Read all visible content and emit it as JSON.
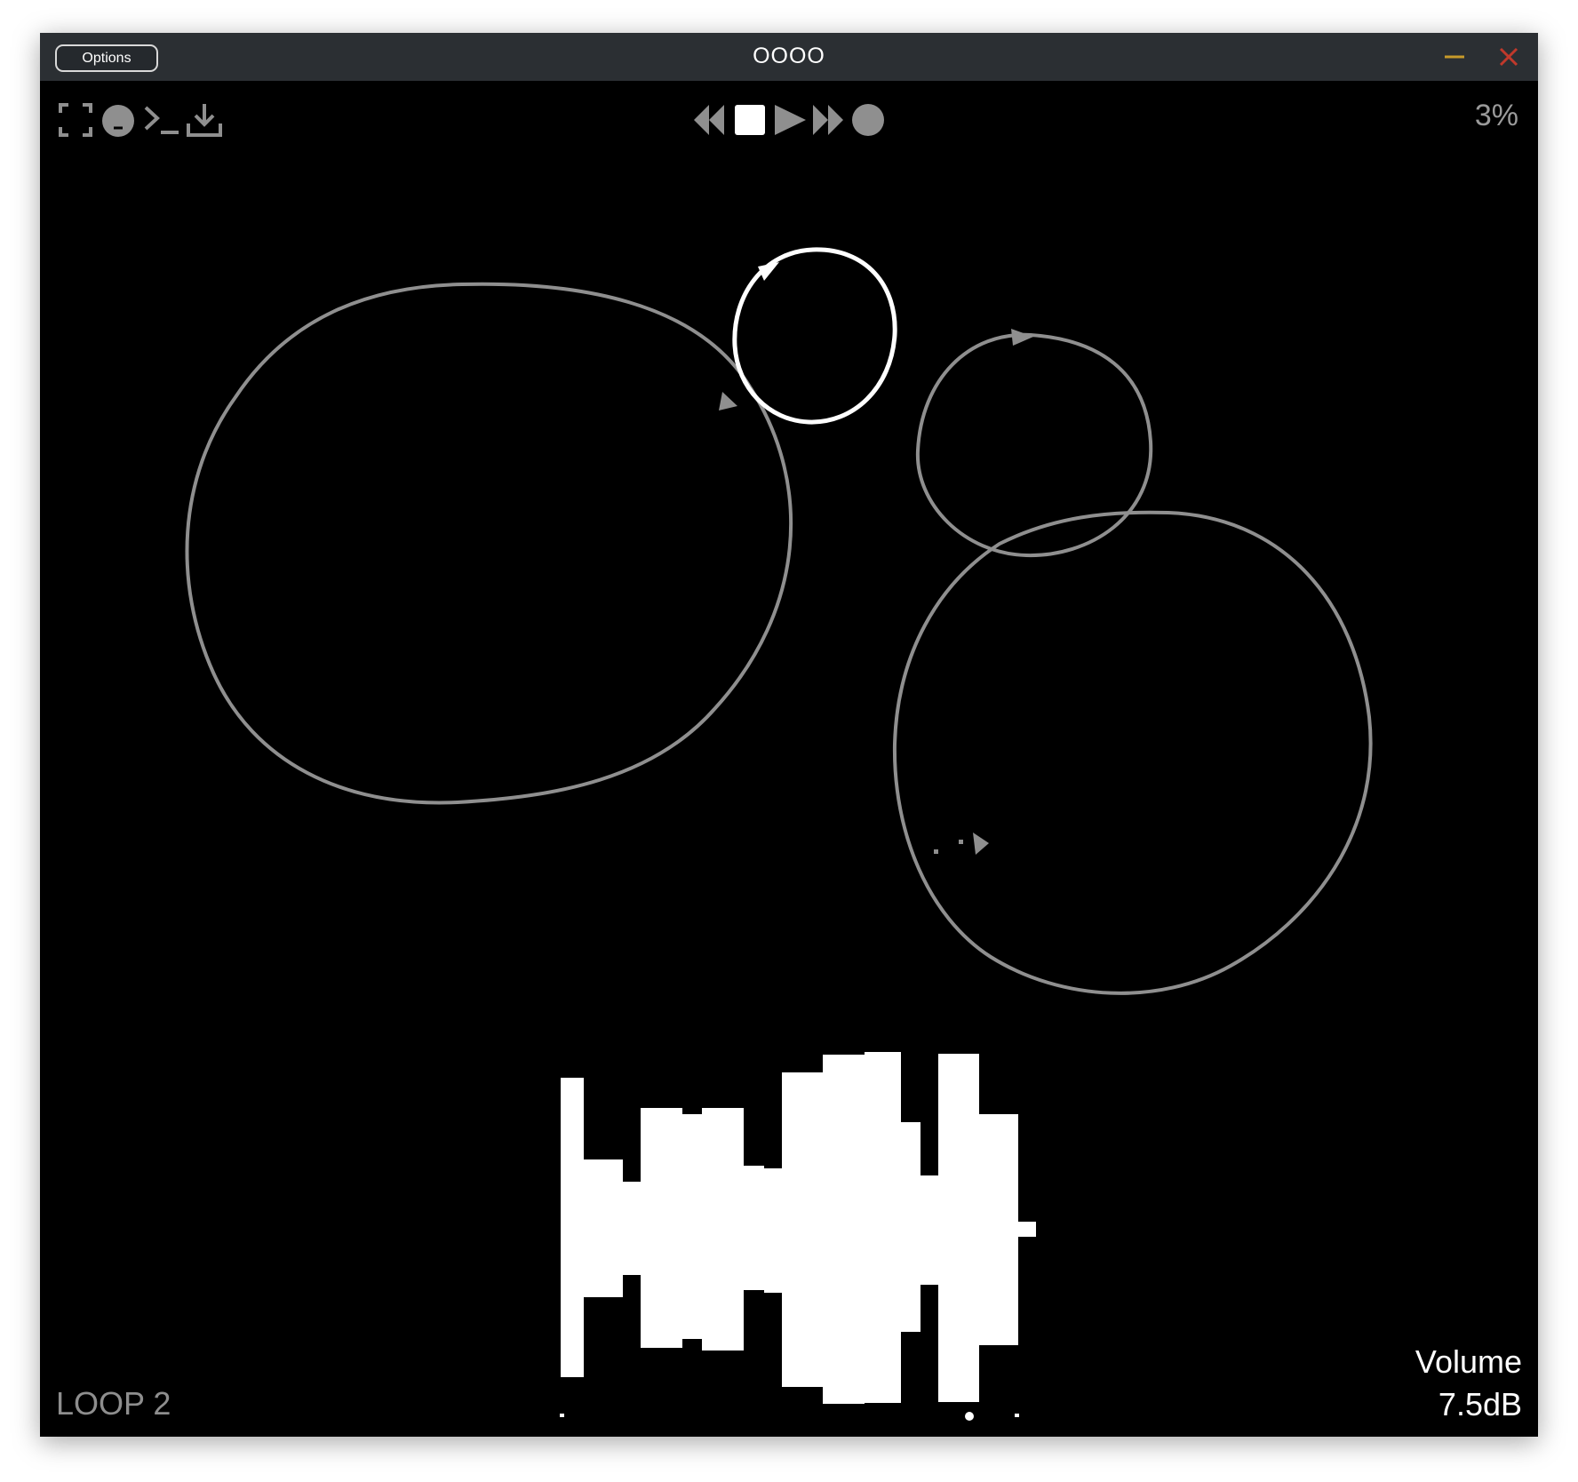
{
  "titlebar": {
    "options_label": "Options",
    "title": "OOOO"
  },
  "toolbar": {
    "left_icons": [
      "fullscreen-icon",
      "face-icon",
      "terminal-icon",
      "download-icon"
    ],
    "transport_icons": [
      "rewind-icon",
      "stop-icon",
      "play-icon",
      "fast-forward-icon",
      "record-icon"
    ],
    "progress": "3%"
  },
  "footer": {
    "loop_label": "LOOP 2",
    "volume_label": "Volume",
    "volume_value": "7.5dB"
  },
  "loops": [
    {
      "name": "loop-large-left",
      "active": false
    },
    {
      "name": "loop-small-center",
      "active": true
    },
    {
      "name": "loop-medium-right",
      "active": false
    },
    {
      "name": "loop-large-right",
      "active": false
    }
  ],
  "colors": {
    "window_bg": "#000000",
    "titlebar_bg": "#2b2f33",
    "loop_inactive": "#8f8f8f",
    "loop_active": "#ffffff",
    "minimize": "#c79a2a",
    "close": "#c0392b",
    "text_dim": "#9a9a9a"
  }
}
